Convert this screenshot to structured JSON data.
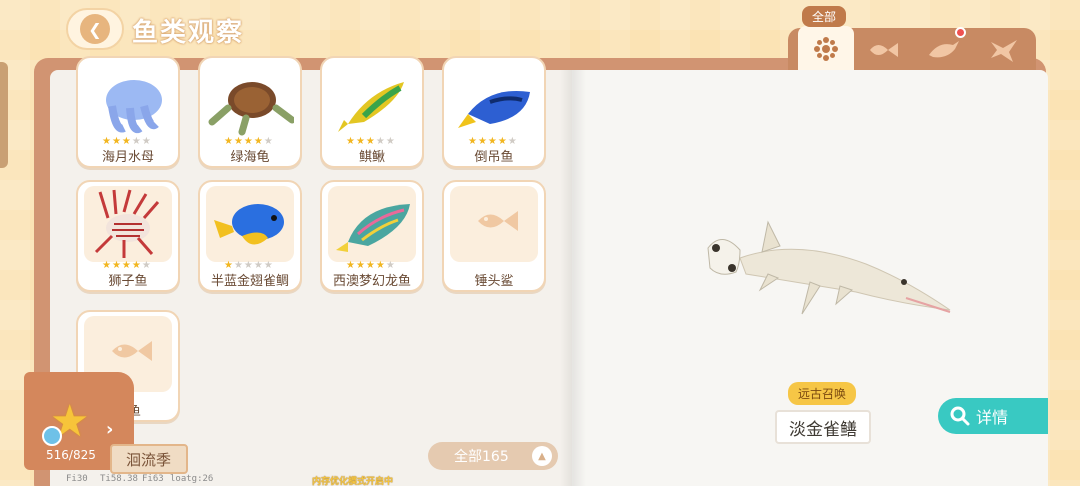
{
  "header": {
    "title": "鱼类观察"
  },
  "tabs": {
    "active_label": "全部",
    "items": [
      {
        "icon": "flower-icon"
      },
      {
        "icon": "fish-icon"
      },
      {
        "icon": "dolphin-icon"
      },
      {
        "icon": "shark-icon"
      }
    ]
  },
  "cards": [
    {
      "name": "海月水母",
      "stars": 3
    },
    {
      "name": "绿海龟",
      "stars": 4
    },
    {
      "name": "鲯鳅",
      "stars": 3
    },
    {
      "name": "倒吊鱼",
      "stars": 4
    },
    {
      "name": "狮子鱼",
      "stars": 4
    },
    {
      "name": "半蓝金翅雀鲷",
      "stars": 1
    },
    {
      "name": "西澳梦幻龙鱼",
      "stars": 4
    },
    {
      "name": "锤头鲨",
      "locked": true
    },
    {
      "name": "剑鱼",
      "locked": true
    }
  ],
  "badge": {
    "count": "516/825"
  },
  "season": {
    "label": "洄流季"
  },
  "total": {
    "label": "全部165"
  },
  "debug": {
    "f1": "Fi30",
    "f2": "Ti58.38",
    "f3": "Fi63",
    "f4": "loatg:26"
  },
  "memory_note": "内存优化模式开启中",
  "detail": {
    "tag": "远古召唤",
    "fish_name": "淡金雀鳝",
    "detail_label": "详情"
  }
}
